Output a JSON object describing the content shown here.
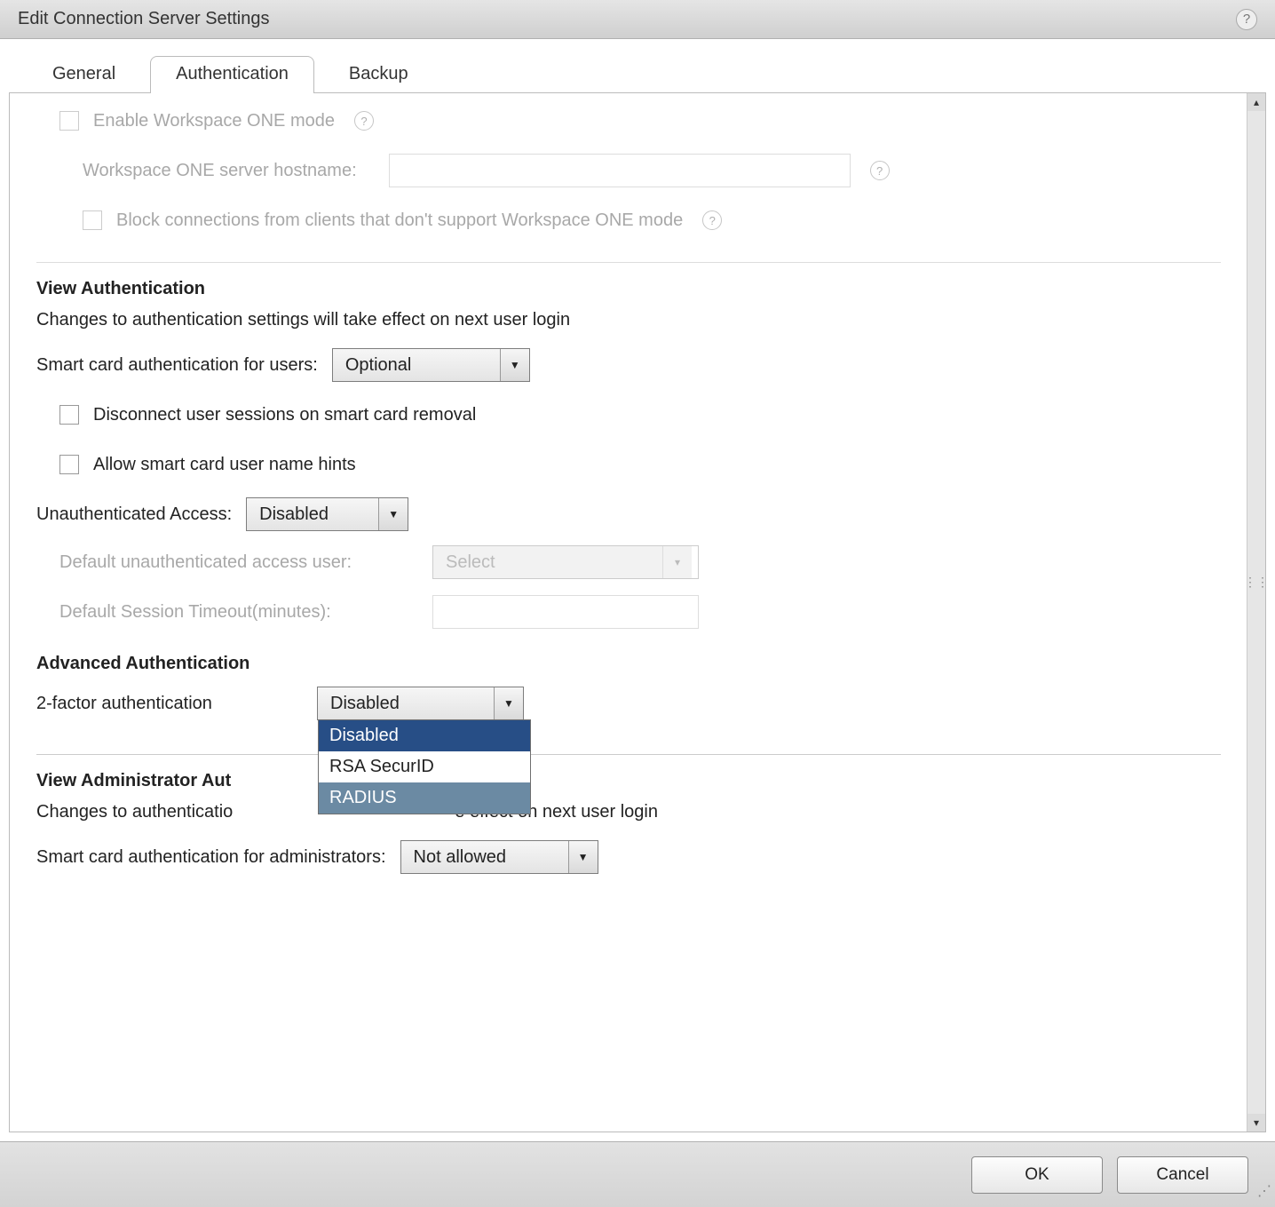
{
  "window": {
    "title": "Edit Connection Server Settings"
  },
  "tabs": {
    "general": "General",
    "authentication": "Authentication",
    "backup": "Backup",
    "active": "authentication"
  },
  "workspace_one": {
    "enable_label": "Enable Workspace ONE mode",
    "hostname_label": "Workspace ONE server hostname:",
    "hostname_value": "",
    "block_label": "Block connections from clients that don't support Workspace ONE mode"
  },
  "view_auth": {
    "title": "View Authentication",
    "note": "Changes to authentication settings will take effect on next user login",
    "smartcard_users_label": "Smart card authentication for users:",
    "smartcard_users_value": "Optional",
    "disconnect_label": "Disconnect user sessions on smart card removal",
    "allow_hints_label": "Allow smart card user name hints",
    "unauth_label": "Unauthenticated Access:",
    "unauth_value": "Disabled",
    "default_user_label": "Default unauthenticated access user:",
    "default_user_value": "Select",
    "timeout_label": "Default Session Timeout(minutes):",
    "timeout_value": ""
  },
  "advanced_auth": {
    "title": "Advanced Authentication",
    "two_factor_label": "2-factor authentication",
    "two_factor_value": "Disabled",
    "options": {
      "disabled": "Disabled",
      "rsa": "RSA SecurID",
      "radius": "RADIUS"
    }
  },
  "admin_auth": {
    "title": "View Administrator Authentication",
    "title_visible_prefix": "View Administrator Aut",
    "note": "Changes to authentication settings will take effect on next user login",
    "note_visible_prefix": "Changes to authenticatio",
    "note_visible_suffix": "e effect on next user login",
    "smartcard_admin_label": "Smart card authentication for administrators:",
    "smartcard_admin_value": "Not allowed"
  },
  "buttons": {
    "ok": "OK",
    "cancel": "Cancel"
  }
}
